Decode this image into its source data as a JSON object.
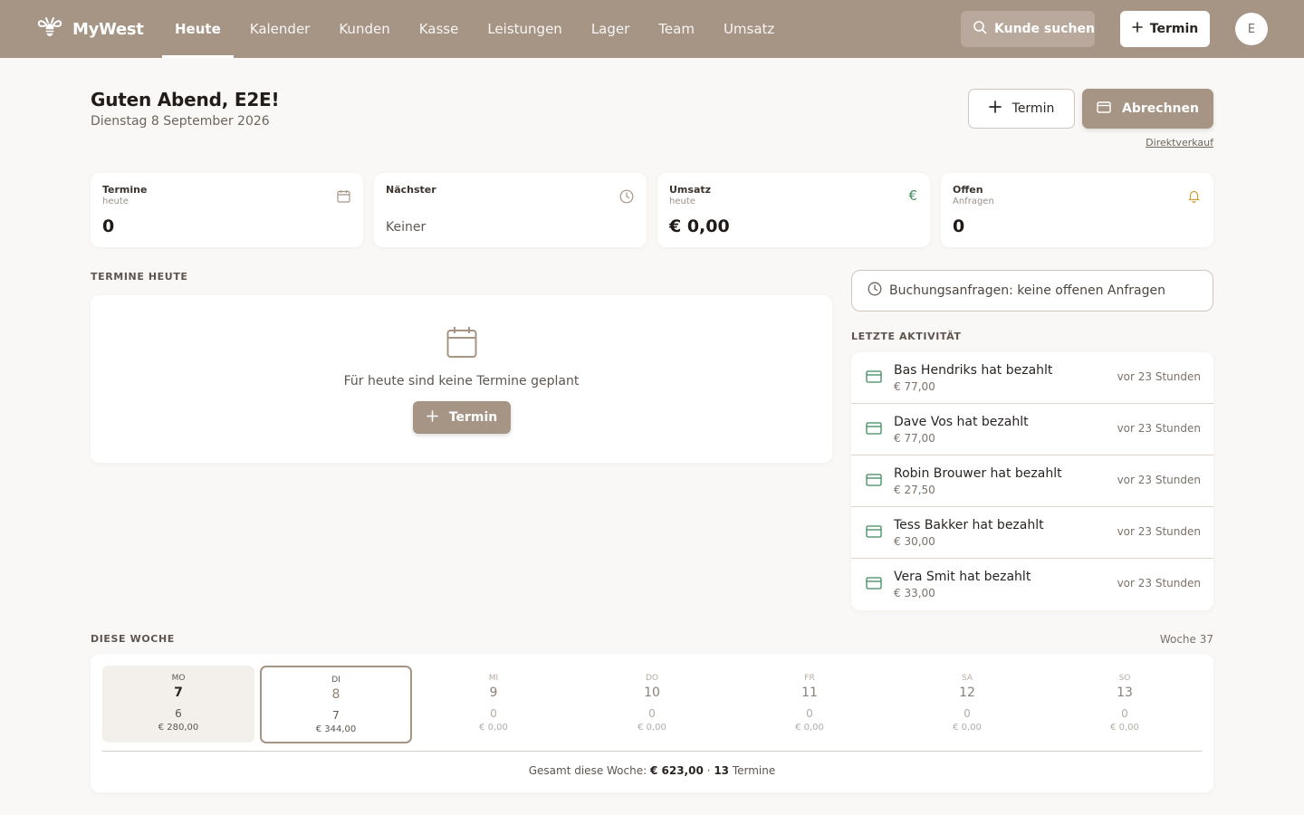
{
  "brand": {
    "name": "MyWest"
  },
  "nav": [
    {
      "label": "Heute",
      "active": true
    },
    {
      "label": "Kalender"
    },
    {
      "label": "Kunden"
    },
    {
      "label": "Kasse"
    },
    {
      "label": "Leistungen"
    },
    {
      "label": "Lager"
    },
    {
      "label": "Team"
    },
    {
      "label": "Umsatz"
    }
  ],
  "topbar": {
    "search_label": "Kunde suchen",
    "termin_label": "Termin",
    "avatar_initial": "E"
  },
  "header": {
    "greeting": "Guten Abend, E2E!",
    "date": "Dienstag 8 September 2026",
    "termin_label": "Termin",
    "abrechnen_label": "Abrechnen",
    "direktverkauf_label": "Direktverkauf"
  },
  "stats": {
    "termine": {
      "label": "Termine",
      "sub": "heute",
      "value": "0"
    },
    "naechster": {
      "label": "Nächster",
      "value": "Keiner"
    },
    "umsatz": {
      "label": "Umsatz",
      "sub": "heute",
      "value": "€ 0,00"
    },
    "offen": {
      "label": "Offen",
      "sub": "Anfragen",
      "value": "0"
    }
  },
  "today": {
    "title": "TERMINE HEUTE",
    "empty_text": "Für heute sind keine Termine geplant",
    "button_label": "Termin"
  },
  "requests": {
    "text": "Buchungsanfragen: keine offenen Anfragen"
  },
  "activity": {
    "title": "LETZTE AKTIVITÄT",
    "items": [
      {
        "name": "Bas Hendriks hat bezahlt",
        "amount": "€ 77,00",
        "time": "vor 23 Stunden"
      },
      {
        "name": "Dave Vos hat bezahlt",
        "amount": "€ 77,00",
        "time": "vor 23 Stunden"
      },
      {
        "name": "Robin Brouwer hat bezahlt",
        "amount": "€ 27,50",
        "time": "vor 23 Stunden"
      },
      {
        "name": "Tess Bakker hat bezahlt",
        "amount": "€ 30,00",
        "time": "vor 23 Stunden"
      },
      {
        "name": "Vera Smit hat bezahlt",
        "amount": "€ 33,00",
        "time": "vor 23 Stunden"
      }
    ]
  },
  "week": {
    "title": "DIESE WOCHE",
    "label": "Woche 37",
    "days": [
      {
        "name": "MO",
        "date": "7",
        "count": "6",
        "revenue": "€ 280,00",
        "state": "past"
      },
      {
        "name": "DI",
        "date": "8",
        "count": "7",
        "revenue": "€ 344,00",
        "state": "today"
      },
      {
        "name": "MI",
        "date": "9",
        "count": "0",
        "revenue": "€ 0,00",
        "state": "future"
      },
      {
        "name": "DO",
        "date": "10",
        "count": "0",
        "revenue": "€ 0,00",
        "state": "future"
      },
      {
        "name": "FR",
        "date": "11",
        "count": "0",
        "revenue": "€ 0,00",
        "state": "future"
      },
      {
        "name": "SA",
        "date": "12",
        "count": "0",
        "revenue": "€ 0,00",
        "state": "future"
      },
      {
        "name": "SO",
        "date": "13",
        "count": "0",
        "revenue": "€ 0,00",
        "state": "future"
      }
    ],
    "total_prefix": "Gesamt diese Woche:",
    "total_revenue": "€ 623,00",
    "total_sep": "·",
    "total_count": "13",
    "total_suffix": "Termine"
  },
  "colors": {
    "primary": "#a69485",
    "activity_icon": "#3f8a5c",
    "offen_icon": "#c9a03a",
    "umsatz_icon": "#3f8a5c"
  }
}
